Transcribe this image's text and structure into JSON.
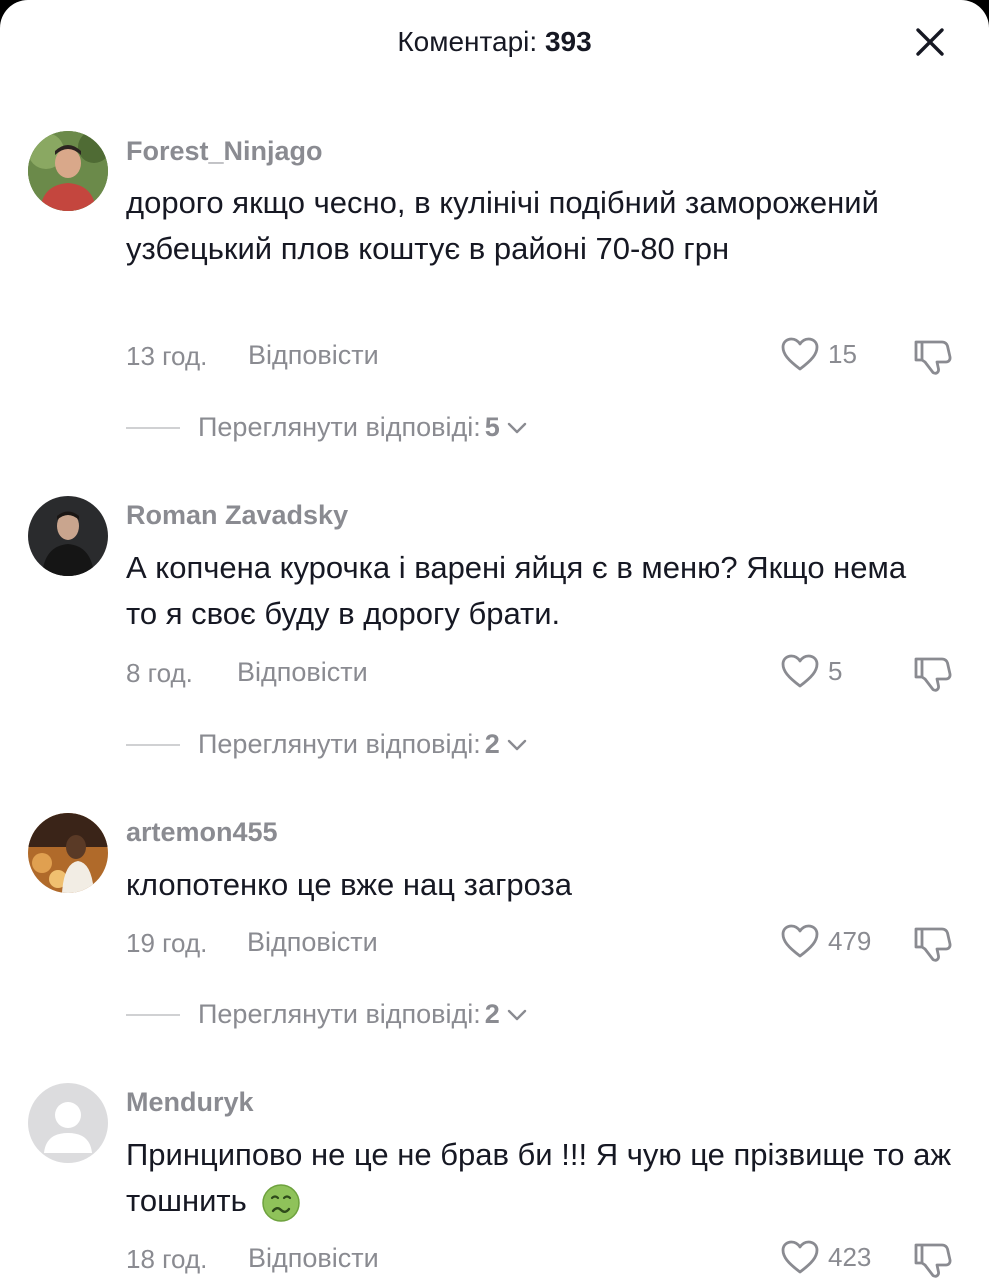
{
  "header": {
    "title_prefix": "Коментарі:",
    "count": "393"
  },
  "comments": [
    {
      "username": "Forest_Ninjago",
      "text": "дорого якщо чесно, в кулінічі подібний заморожений узбецький плов коштує в районі 70-80 грн",
      "time": "13 год.",
      "reply_label": "Відповісти",
      "likes": "15",
      "view_replies_label": "Переглянути відповіді:",
      "replies_count": "5"
    },
    {
      "username": "Roman Zavadsky",
      "text": "А копчена курочка і варені яйця є в меню? Якщо нема то я своє буду в дорогу брати.",
      "time": "8 год.",
      "reply_label": "Відповісти",
      "likes": "5",
      "view_replies_label": "Переглянути відповіді:",
      "replies_count": "2"
    },
    {
      "username": "artemon455",
      "text": "клопотенко це вже нац загроза",
      "time": "19 год.",
      "reply_label": "Відповісти",
      "likes": "479",
      "view_replies_label": "Переглянути відповіді:",
      "replies_count": "2"
    },
    {
      "username": "Menduryk",
      "text": "Принципово не це не брав би !!! Я чую це прізвище то аж тошнить",
      "emoji": "nauseated-face-icon",
      "time": "18 год.",
      "reply_label": "Відповісти",
      "likes": "423"
    }
  ]
}
